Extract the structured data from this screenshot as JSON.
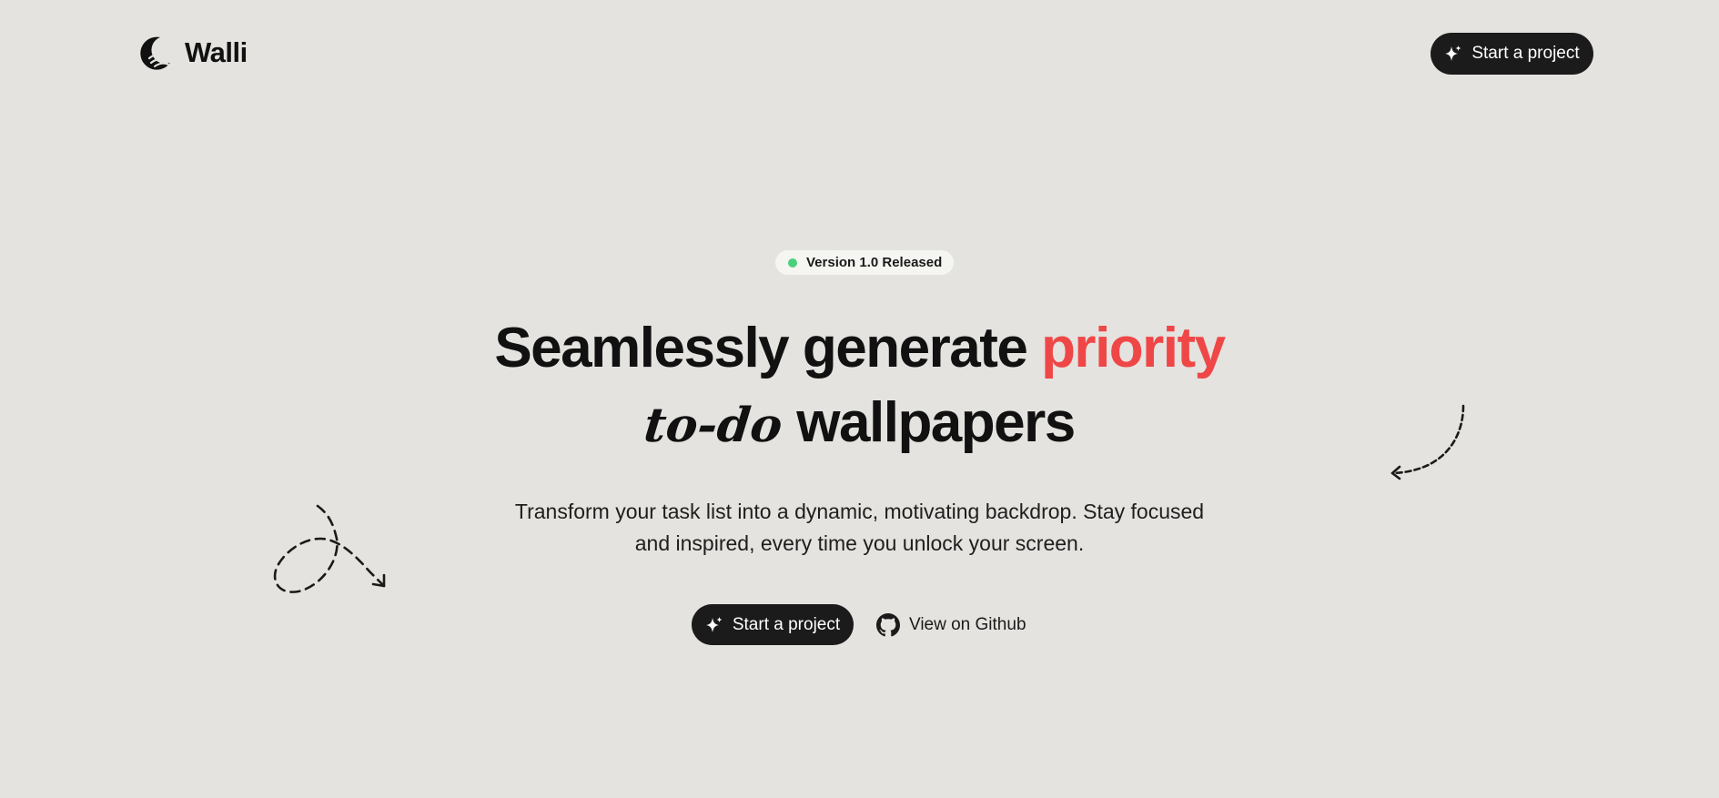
{
  "brand": {
    "name": "Walli",
    "logo_icon": "crescent-logo-icon"
  },
  "nav": {
    "cta_label": "Start a project",
    "cta_icon": "sparkle-icon"
  },
  "hero": {
    "badge": {
      "text": "Version 1.0 Released",
      "dot_color": "#4ad07b"
    },
    "headline": {
      "line1_start": "Seamlessly generate",
      "line1_accent": "priority",
      "line2_script": "to-do",
      "line2_end": "wallpapers",
      "accent_color": "#ef4747"
    },
    "subtitle": {
      "line1": "Transform your task list into a dynamic, motivating backdrop. Stay focused",
      "line2": "and inspired, every time you unlock your screen."
    },
    "primary_cta": {
      "label": "Start a project",
      "icon": "sparkle-icon"
    },
    "secondary_cta": {
      "label": "View on Github",
      "icon": "github-icon"
    }
  },
  "colors": {
    "background": "#e4e3df",
    "button_dark": "#1c1b1b",
    "text": "#111111"
  }
}
